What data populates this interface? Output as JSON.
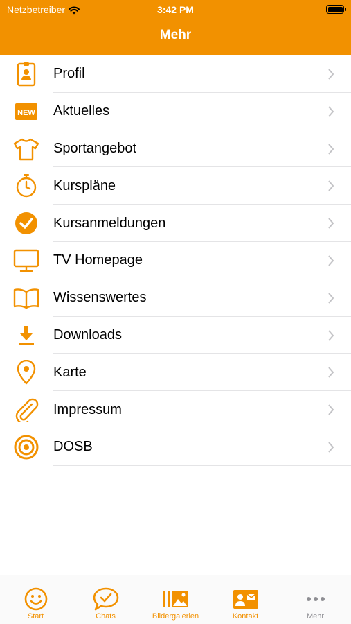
{
  "status_bar": {
    "carrier": "Netzbetreiber",
    "time": "3:42 PM"
  },
  "nav": {
    "title": "Mehr"
  },
  "accent_color": "#f29100",
  "menu": [
    {
      "label": "Profil",
      "icon": "id-badge-icon"
    },
    {
      "label": "Aktuelles",
      "icon": "new-badge-icon",
      "badge_text": "NEW"
    },
    {
      "label": "Sportangebot",
      "icon": "tshirt-icon"
    },
    {
      "label": "Kurspläne",
      "icon": "stopwatch-icon"
    },
    {
      "label": "Kursanmeldungen",
      "icon": "check-circle-icon"
    },
    {
      "label": "TV Homepage",
      "icon": "monitor-icon"
    },
    {
      "label": "Wissenswertes",
      "icon": "open-book-icon"
    },
    {
      "label": "Downloads",
      "icon": "download-icon"
    },
    {
      "label": "Karte",
      "icon": "map-pin-icon"
    },
    {
      "label": "Impressum",
      "icon": "paperclip-icon"
    },
    {
      "label": "DOSB",
      "icon": "target-icon"
    }
  ],
  "tabs": [
    {
      "label": "Start",
      "icon": "smiley-icon",
      "active": false
    },
    {
      "label": "Chats",
      "icon": "chat-bubble-icon",
      "active": false
    },
    {
      "label": "Bildergalerien",
      "icon": "gallery-icon",
      "active": false
    },
    {
      "label": "Kontakt",
      "icon": "contact-card-icon",
      "active": false
    },
    {
      "label": "Mehr",
      "icon": "more-dots-icon",
      "active": true
    }
  ]
}
